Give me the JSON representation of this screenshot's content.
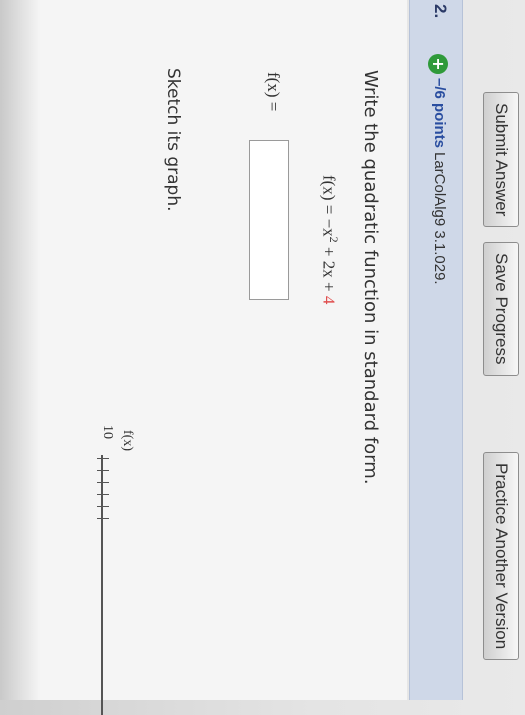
{
  "buttons": {
    "submit": "Submit Answer",
    "save": "Save Progress",
    "practice": "Practice Another Version"
  },
  "question": {
    "number": "2.",
    "points": "–/6 points",
    "source": "LarColAlg9 3.1.029."
  },
  "content": {
    "instruction": "Write the quadratic function in standard form.",
    "eq_prefix": "f(x) = −x",
    "eq_exp": "2",
    "eq_mid": " + 2x + ",
    "eq_red": "4",
    "answer_label": "f(x) =",
    "answer_value": "",
    "sketch_prompt": "Sketch its graph."
  },
  "graph": {
    "y_label": "f(x)",
    "tick_label": "10"
  },
  "colors": {
    "header_bar": "#cfd8e8",
    "points_blue": "#2a4ea0",
    "highlight_red": "#e04e4e",
    "plus_green": "#2f9a3a"
  }
}
